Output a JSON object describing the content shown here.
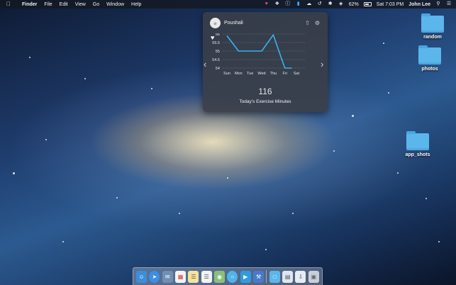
{
  "menubar": {
    "app_name": "Finder",
    "menus": [
      "File",
      "Edit",
      "View",
      "Go",
      "Window",
      "Help"
    ],
    "battery_percent": "62%",
    "clock": "Sat 7:03 PM",
    "user": "John Lee"
  },
  "desktop": {
    "icons": [
      {
        "label": "random"
      },
      {
        "label": "photos"
      },
      {
        "label": "app_shots"
      }
    ]
  },
  "widget": {
    "user_name": "Poushali",
    "metric_value": "116",
    "metric_label": "Today's Exercise Minutes",
    "chart_data": {
      "type": "line",
      "categories": [
        "Sun",
        "Mon",
        "Tue",
        "Wed",
        "Thu",
        "Fri",
        "Sat"
      ],
      "series": [
        {
          "values": [
            55.9,
            55.0,
            55.0,
            55.0,
            55.95,
            54.0,
            null
          ]
        }
      ],
      "ytick_labels": [
        "56",
        "55.5",
        "55",
        "54.5",
        "54"
      ],
      "ylim": [
        54,
        56
      ],
      "grid": true,
      "line_color": "#36b3ec"
    }
  },
  "dock": {
    "items": [
      "finder-icon",
      "safari-icon",
      "mail-icon",
      "calendar-icon",
      "notes-icon",
      "reminders-icon",
      "maps-icon",
      "messages-icon",
      "facetime-icon",
      "xcode-icon",
      "folder-icon",
      "documents-icon",
      "downloads-icon",
      "trash-icon"
    ]
  }
}
